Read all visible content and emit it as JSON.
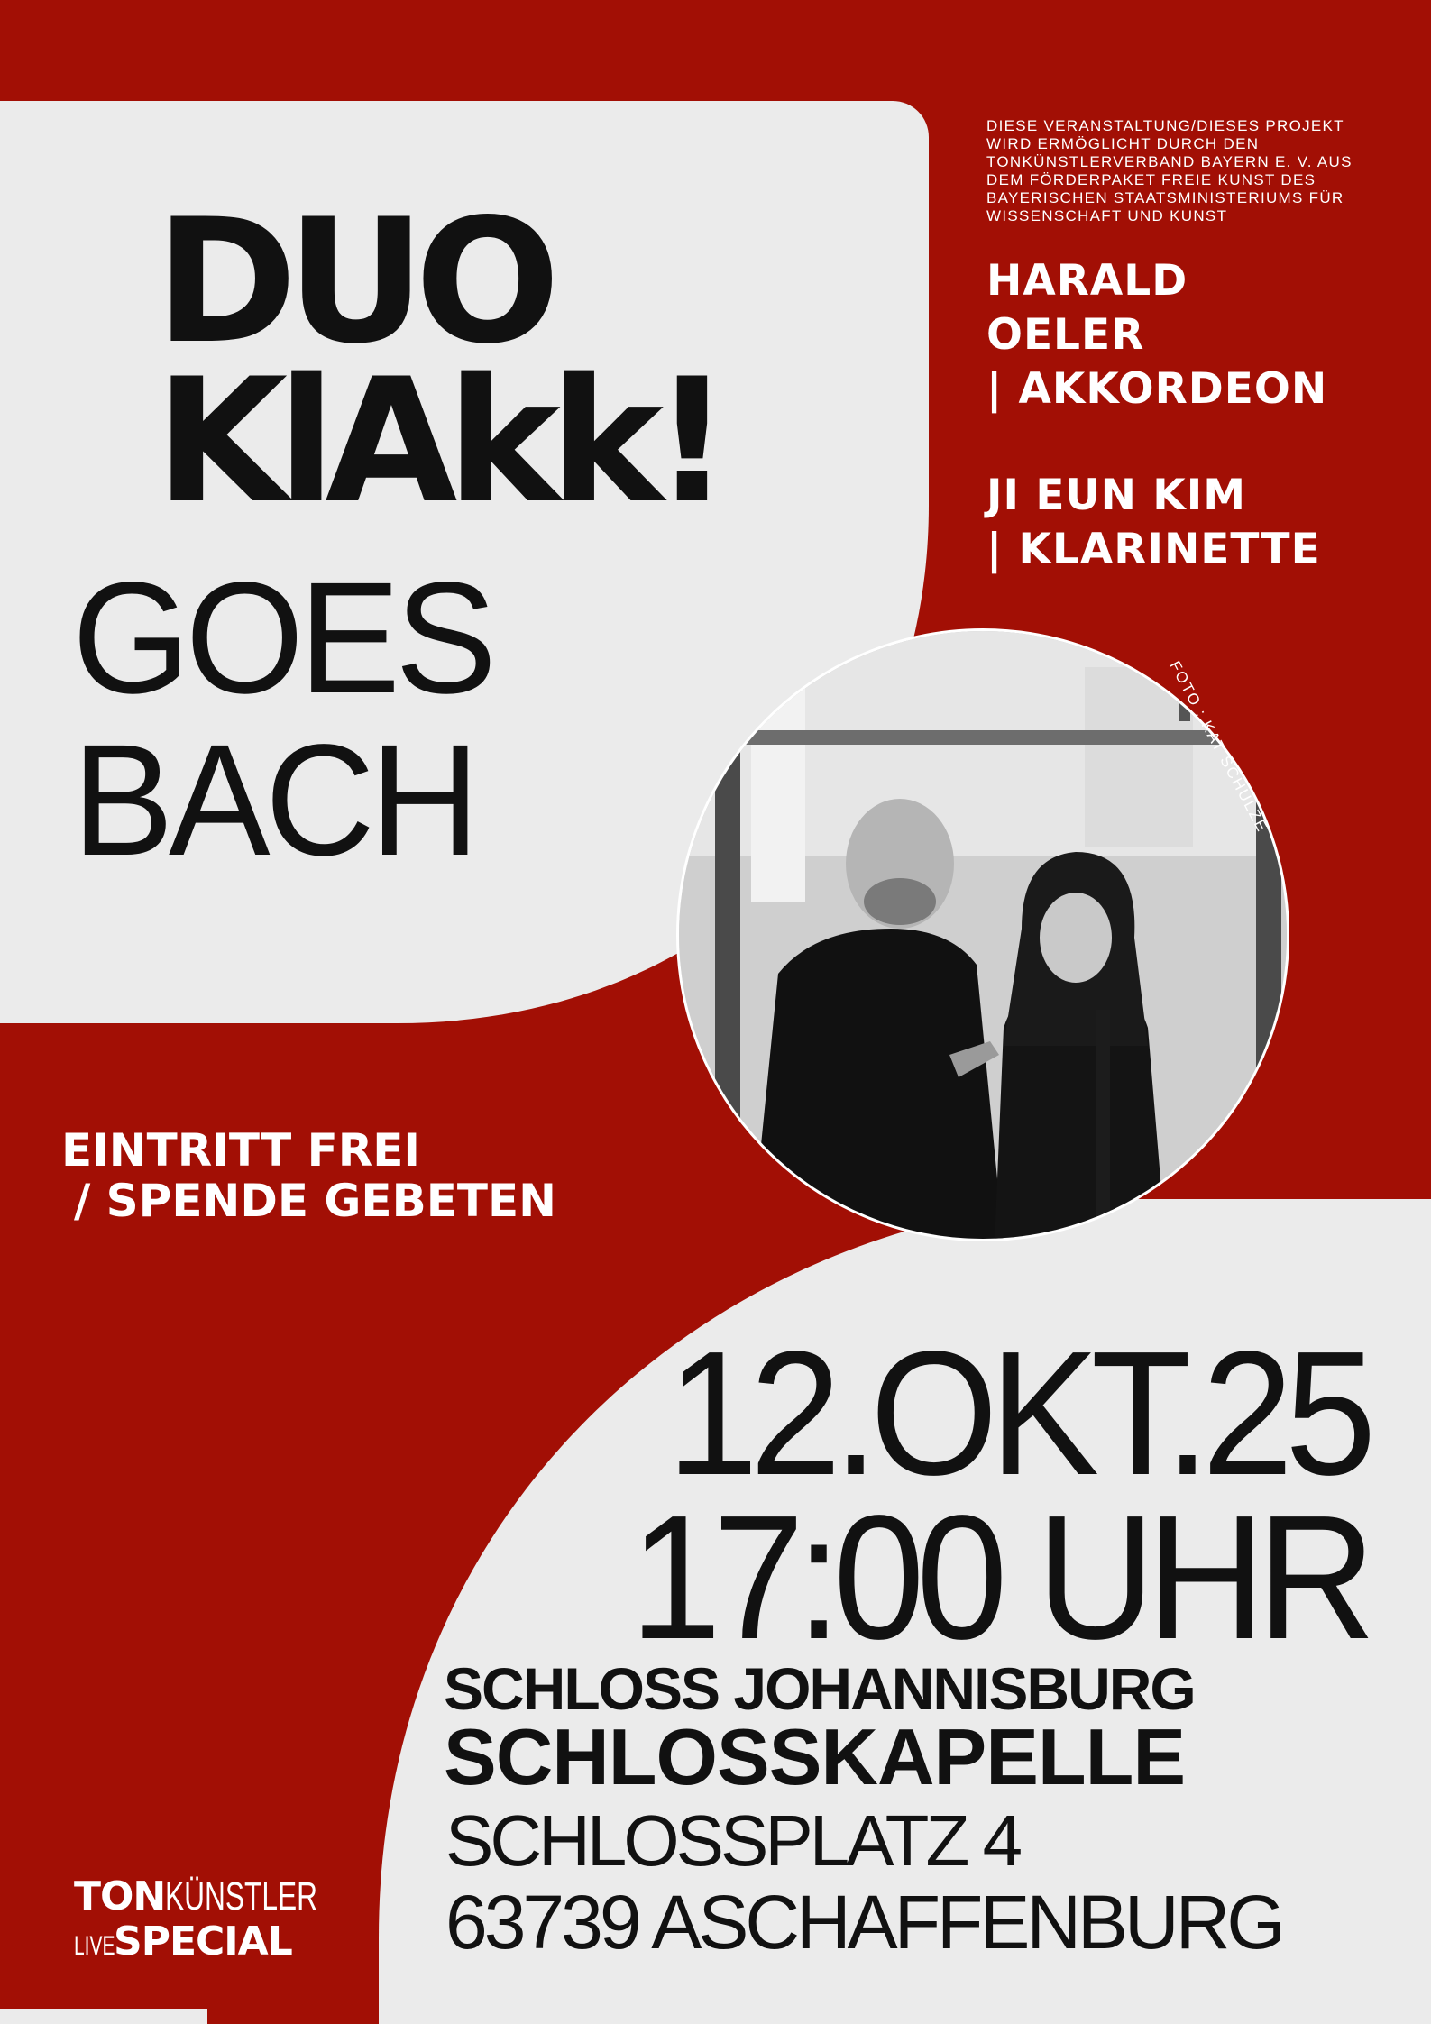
{
  "poster": {
    "title_line1": "DUO",
    "title_line2": "KlAkk!",
    "title_line3": "GOES",
    "title_line4": "BACH",
    "sponsor_note": "DIESE VERANSTALTUNG/DIESES PROJEKT WIRD ERMÖGLICHT DURCH DEN TONKÜNSTLERVERBAND BAYERN E. V. AUS DEM FÖRDERPAKET FREIE KUNST DES BAYERISCHEN STAATSMINISTERIUMS FÜR WISSENSCHAFT UND KUNST",
    "artists": [
      {
        "line1": "HARALD",
        "line2": "OELER",
        "line3": "| AKKORDEON"
      },
      {
        "line1": "JI EUN KIM",
        "line2": "| KLARINETTE"
      }
    ],
    "photo_credit": "FOTO : KAT SCHULZE",
    "admission_line1": "EINTRITT FREI",
    "admission_line2": "/ SPENDE GEBETEN",
    "date": "12.OKT.25",
    "time": "17:00 UHR",
    "venue_name": "SCHLOSS JOHANNISBURG",
    "venue_room": "SCHLOSSKAPELLE",
    "venue_street": "SCHLOSSPLATZ 4",
    "venue_city": "63739 ASCHAFFENBURG",
    "logo": {
      "ton": "TON",
      "kuenstler": "KÜNSTLER",
      "live": "LIVE",
      "special": "SPECIAL"
    },
    "colors": {
      "red": "#a20f05",
      "light": "#ebebeb",
      "ink": "#111111"
    }
  }
}
